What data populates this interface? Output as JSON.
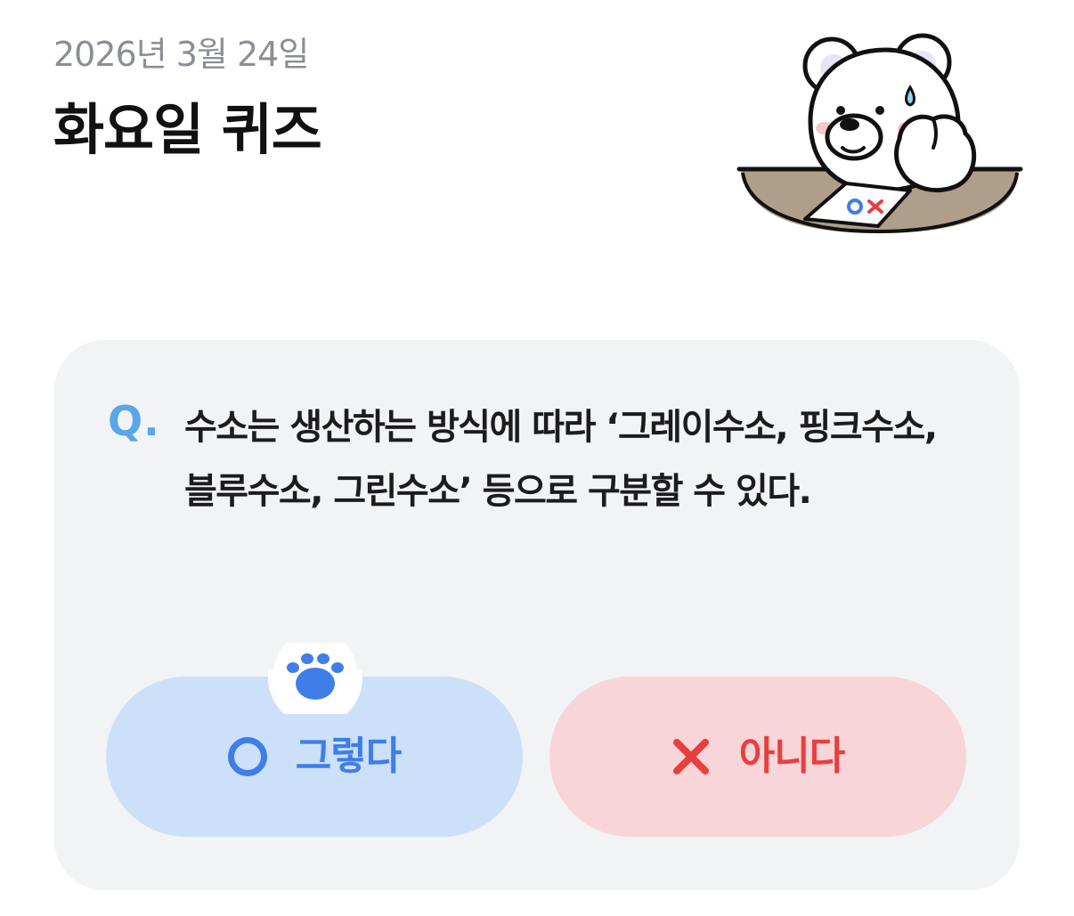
{
  "header": {
    "date": "2026년 3월 24일",
    "title": "화요일 퀴즈"
  },
  "mascot": {
    "icon": "polar-bear-thinking-icon",
    "sheet_o": "O",
    "sheet_x": "X"
  },
  "quiz": {
    "q_mark": "Q.",
    "question": "수소는 생산하는 방식에 따라 ‘그레이수소, 핑크수소, 블루수소, 그린수소’ 등으로 구분할 수 있다.",
    "answers": [
      {
        "label": "그렇다",
        "icon": "circle-o-icon",
        "color": "#3f7ee8",
        "background": "#cde0fa"
      },
      {
        "label": "아니다",
        "icon": "x-mark-icon",
        "color": "#e83f3f",
        "background": "#f7d5d8"
      }
    ],
    "selected_hint_icon": "paw-icon"
  },
  "colors": {
    "card_background": "#f2f3f5",
    "q_accent": "#57a7ea",
    "title": "#111111",
    "date": "#8b8e95"
  }
}
